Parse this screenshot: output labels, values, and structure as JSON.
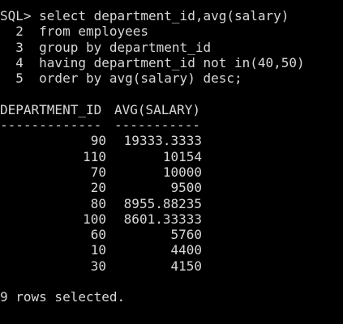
{
  "terminal": {
    "prompt": "SQL>",
    "query_lines": [
      {
        "number": "",
        "text": "SQL> select department_id,avg(salary)"
      },
      {
        "number": "2",
        "text": "  2  from employees"
      },
      {
        "number": "3",
        "text": "  3  group by department_id"
      },
      {
        "number": "4",
        "text": "  4  having department_id not in(40,50)"
      },
      {
        "number": "5",
        "text": "  5  order by avg(salary) desc;"
      }
    ],
    "result": {
      "columns": [
        "DEPARTMENT_ID",
        "AVG(SALARY)"
      ],
      "separators": [
        "-------------",
        "-----------"
      ],
      "rows": [
        {
          "department_id": "90",
          "avg_salary": "19333.3333"
        },
        {
          "department_id": "110",
          "avg_salary": "10154"
        },
        {
          "department_id": "70",
          "avg_salary": "10000"
        },
        {
          "department_id": "20",
          "avg_salary": "9500"
        },
        {
          "department_id": "80",
          "avg_salary": "8955.88235"
        },
        {
          "department_id": "100",
          "avg_salary": "8601.33333"
        },
        {
          "department_id": "60",
          "avg_salary": "5760"
        },
        {
          "department_id": "10",
          "avg_salary": "4400"
        },
        {
          "department_id": "30",
          "avg_salary": "4150"
        }
      ]
    },
    "footer": "9 rows selected.",
    "colors": {
      "background": "#000000",
      "text": "#d8d8d8"
    }
  }
}
